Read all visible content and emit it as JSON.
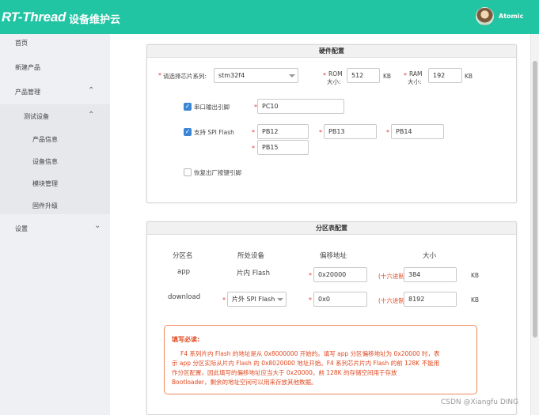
{
  "header": {
    "logo": "RT-Thread",
    "title": "设备维护云",
    "username": "Atomic"
  },
  "sidebar": {
    "items": [
      {
        "label": "首页"
      },
      {
        "label": "新建产品"
      },
      {
        "label": "产品管理"
      },
      {
        "label": "测试设备"
      },
      {
        "label": "产品信息"
      },
      {
        "label": "设备信息"
      },
      {
        "label": "模块管理"
      },
      {
        "label": "固件升级"
      },
      {
        "label": "设置"
      }
    ]
  },
  "hardware": {
    "title": "硬件配置",
    "chip_series_label": "请选择芯片系列:",
    "chip_series_value": "stm32f4",
    "rom_label_1": "ROM",
    "rom_label_2": "大小:",
    "rom_value": "512",
    "rom_unit": "KB",
    "ram_label_1": "RAM",
    "ram_label_2": "大小:",
    "ram_value": "192",
    "ram_unit": "KB",
    "uart_label": "串口输出引脚",
    "uart_checked": true,
    "uart_pin": "PC10",
    "spi_label": "支持 SPI Flash",
    "spi_checked": true,
    "spi_pins": [
      "PB12",
      "PB13",
      "PB14",
      "PB15"
    ],
    "reset_label": "恢复出厂按键引脚",
    "reset_checked": false
  },
  "partition": {
    "title": "分区表配置",
    "headers": [
      "分区名",
      "所处设备",
      "偏移地址",
      "大小"
    ],
    "hex_hint": "(十六进制",
    "rows": [
      {
        "name": "app",
        "device": "片内 Flash",
        "offset": "0x20000",
        "size": "384",
        "unit": "KB"
      },
      {
        "name": "download",
        "device": "片外 SPI Flash",
        "offset": "0x0",
        "size": "8192",
        "unit": "KB"
      }
    ],
    "notice_title": "填写必读:",
    "notice_line1": "F4 系列片内 Flash 的地址是从 0x8000000 开始的。填写 app 分区偏移地址为 0x20000 时，表",
    "notice_line2": "示 app 分区实际从片内 Flash 的 0x8020000 地址开始。F4 系列芯片片内 Flash 的前 128K 不能用",
    "notice_line3": "作分区配置，因此填写的偏移地址应当大于 0x20000。前 128K 的存储空间用于存放",
    "notice_line4": "Bootloader，剩余的地址空间可以用来存放其他数据。"
  },
  "watermark": "CSDN @Xiangfu DING",
  "colors": {
    "accent": "#21c4a3",
    "checkbox": "#3a85d6",
    "warning": "#e0481f"
  }
}
